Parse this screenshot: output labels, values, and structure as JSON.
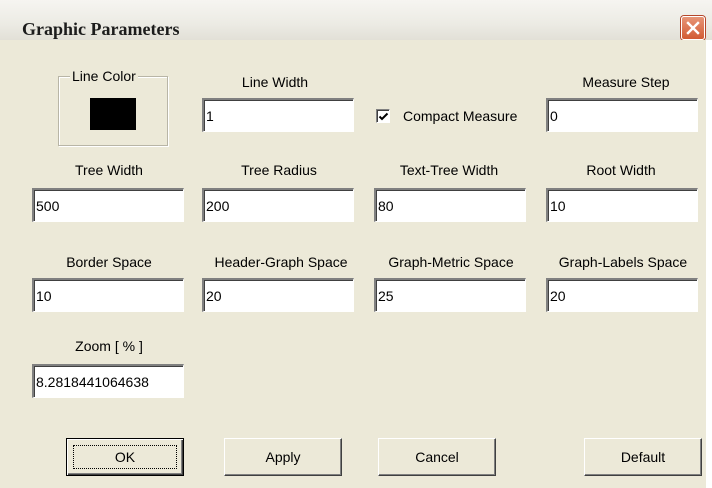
{
  "window": {
    "title": "Graphic Parameters",
    "close_icon": "close-icon"
  },
  "line_color": {
    "label": "Line Color",
    "color": "#000000"
  },
  "line_width": {
    "label": "Line Width",
    "value": "1"
  },
  "compact_measure": {
    "label": "Compact Measure",
    "checked": true
  },
  "measure_step": {
    "label": "Measure Step",
    "value": "0"
  },
  "tree_width": {
    "label": "Tree Width",
    "value": "500"
  },
  "tree_radius": {
    "label": "Tree Radius",
    "value": "200"
  },
  "text_tree_width": {
    "label": "Text-Tree Width",
    "value": "80"
  },
  "root_width": {
    "label": "Root Width",
    "value": "10"
  },
  "border_space": {
    "label": "Border Space",
    "value": "10"
  },
  "header_graph_space": {
    "label": "Header-Graph Space",
    "value": "20"
  },
  "graph_metric_space": {
    "label": "Graph-Metric Space",
    "value": "25"
  },
  "graph_labels_space": {
    "label": "Graph-Labels Space",
    "value": "20"
  },
  "zoom": {
    "label": "Zoom [ % ]",
    "value": "8.2818441064638"
  },
  "buttons": {
    "ok": "OK",
    "apply": "Apply",
    "cancel": "Cancel",
    "default": "Default"
  },
  "colors": {
    "dialog_bg": "#ece9d8",
    "close_button": "#d25a33"
  }
}
